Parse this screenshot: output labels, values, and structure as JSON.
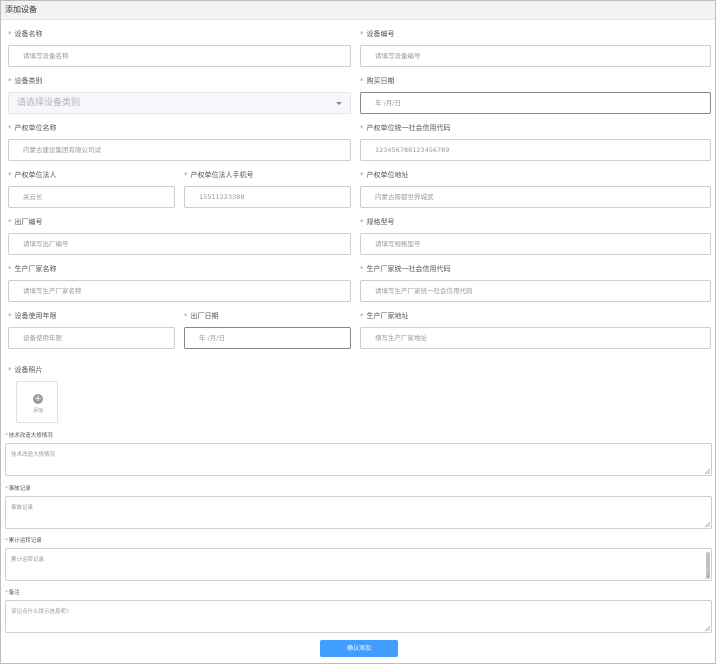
{
  "header": {
    "title": "添加设备"
  },
  "fields": {
    "device_name": {
      "label": "设备名称",
      "value": "请填写设备名称"
    },
    "device_code": {
      "label": "设备编号",
      "value": "请填写设备编号"
    },
    "device_category": {
      "label": "设备类别",
      "value": "请选择设备类别"
    },
    "purchase_date": {
      "label": "购买日期",
      "value": "年 /月/日"
    },
    "owner_unit_name": {
      "label": "产权单位名称",
      "value": "内蒙古建设集团有限公司试"
    },
    "owner_credit_code": {
      "label": "产权单位统一社会信用代码",
      "value": "123456788123456789"
    },
    "owner_legal_person": {
      "label": "产权单位法人",
      "value": "关云长"
    },
    "owner_legal_phone": {
      "label": "产权单位法人手机号",
      "value": "15511223388"
    },
    "owner_address": {
      "label": "产权单位地址",
      "value": "内蒙古周都世界城武"
    },
    "factory_code": {
      "label": "出厂编号",
      "value": "请填写出厂编号"
    },
    "spec_model": {
      "label": "规格型号",
      "value": "请填写规格型号"
    },
    "manufacturer_name": {
      "label": "生产厂家名称",
      "value": "请填写生产厂家名称"
    },
    "manufacturer_credit_code": {
      "label": "生产厂家统一社会信用代码",
      "value": "请填写生产厂家统一社会信用代码"
    },
    "service_years": {
      "label": "设备使用年限",
      "value": "设备使用年限"
    },
    "factory_date": {
      "label": "出厂日期",
      "value": "年 /月/日"
    },
    "manufacturer_address": {
      "label": "生产厂家地址",
      "value": "填写生产厂家地址"
    },
    "device_photo": {
      "label": "设备照片",
      "upload_text": "添加"
    },
    "tech_renovation": {
      "label": "技术改造大修情况",
      "value": "技术改造大修情况"
    },
    "accident_record": {
      "label": "事故记录",
      "value": "事故记录"
    },
    "cumulative_operation": {
      "label": "累计运转记录",
      "value": "累计运转记录"
    },
    "remarks": {
      "label": "备注",
      "value": "该记点什么提示信息呢?"
    }
  },
  "required_mark": "*",
  "submit_button": {
    "label": "确认添加"
  },
  "colors": {
    "accent": "#409eff",
    "required": "#f56c6c"
  }
}
